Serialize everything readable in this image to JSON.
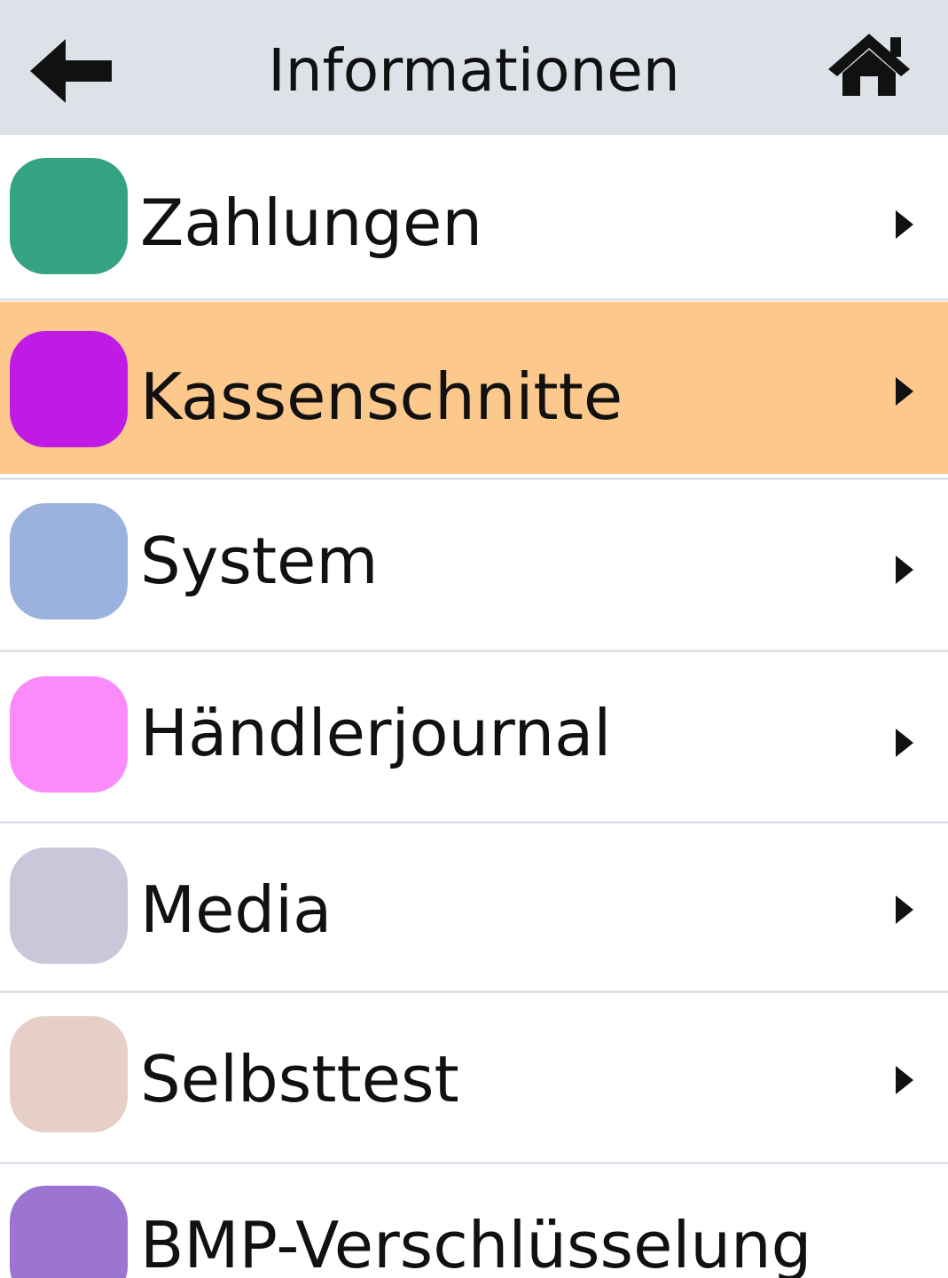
{
  "header": {
    "title": "Informationen",
    "back_icon": "arrow-left-icon",
    "home_icon": "home-icon",
    "background": "#dde1e8"
  },
  "menu": {
    "items": [
      {
        "label": "Zahlungen",
        "color": "#33a382",
        "selected": false
      },
      {
        "label": "Kassenschnitte",
        "color": "#c01ae6",
        "selected": true
      },
      {
        "label": "System",
        "color": "#9bb1de",
        "selected": false
      },
      {
        "label": "Händlerjournal",
        "color": "#fb8bfb",
        "selected": false
      },
      {
        "label": "Media",
        "color": "#c9c7d9",
        "selected": false
      },
      {
        "label": "Selbsttest",
        "color": "#e6cfc6",
        "selected": false
      },
      {
        "label": "BMP-Verschlüsselung",
        "color": "#9c74d2",
        "selected": false
      }
    ],
    "chevron_icon": "chevron-right-icon",
    "selected_background": "#fdc88c"
  }
}
